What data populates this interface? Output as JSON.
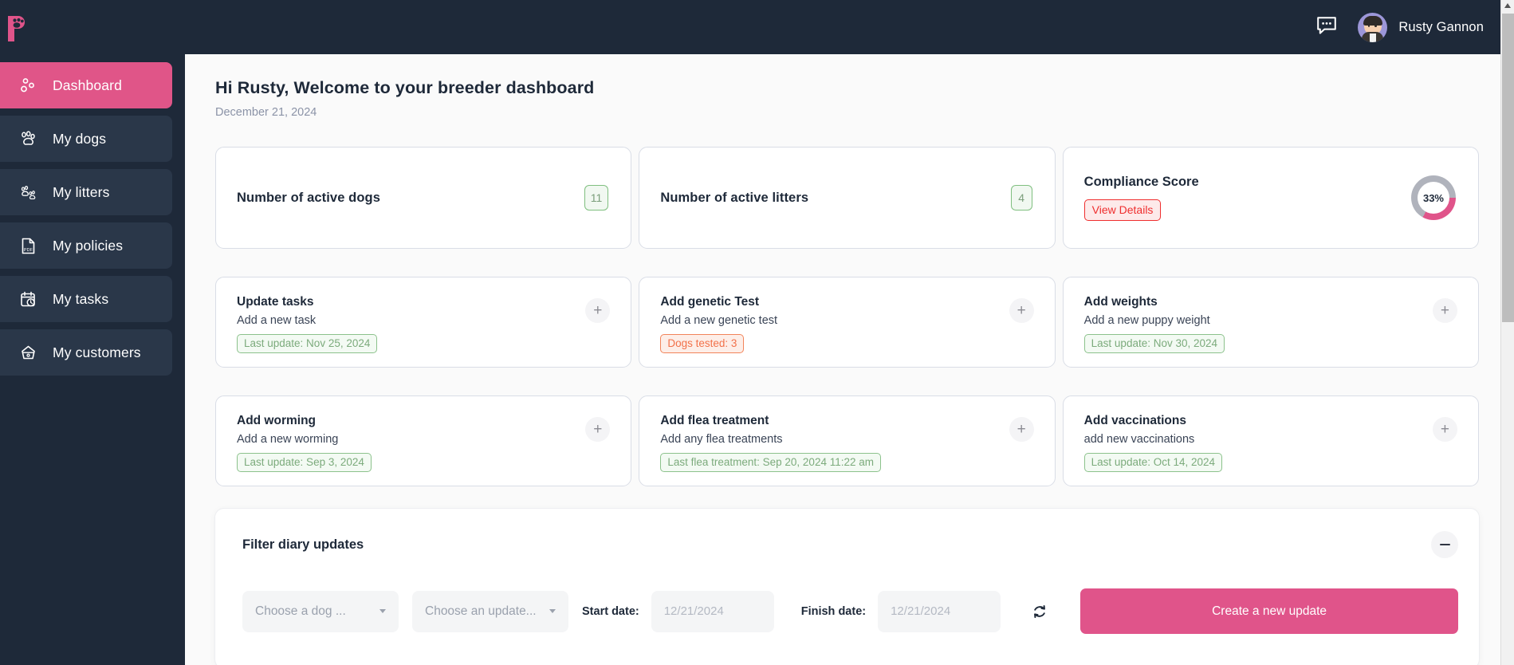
{
  "brand": {
    "logo_icon": "paw-p-logo-icon",
    "accent": "#e0548a",
    "dark": "#1e2939"
  },
  "topbar": {
    "chat_icon": "chat-bubble-icon",
    "user_name": "Rusty Gannon",
    "avatar_icon": "user-avatar"
  },
  "sidebar": {
    "items": [
      {
        "label": "Dashboard",
        "icon": "paw-dots-icon",
        "active": true
      },
      {
        "label": "My dogs",
        "icon": "paw-print-icon",
        "active": false
      },
      {
        "label": "My litters",
        "icon": "paw-litter-icon",
        "active": false
      },
      {
        "label": "My policies",
        "icon": "pdf-file-icon",
        "active": false
      },
      {
        "label": "My tasks",
        "icon": "calendar-clock-icon",
        "active": false
      },
      {
        "label": "My customers",
        "icon": "crown-icon",
        "active": false
      }
    ]
  },
  "main": {
    "greeting": "Hi Rusty, Welcome to your breeder dashboard",
    "date": "December 21, 2024",
    "stats": [
      {
        "title": "Number of active dogs",
        "value": "11"
      },
      {
        "title": "Number of active litters",
        "value": "4"
      }
    ],
    "compliance": {
      "title": "Compliance Score",
      "details_label": "View Details",
      "percent_label": "33%",
      "percent_value": 33,
      "fill_color": "#e0548a",
      "track_color": "#b0b3bc"
    },
    "actions": [
      {
        "title": "Update tasks",
        "subtitle": "Add a new task",
        "badge": "Last update: Nov 25, 2024",
        "badge_tone": "green",
        "add_icon": "plus-icon"
      },
      {
        "title": "Add genetic Test",
        "subtitle": "Add a new genetic test",
        "badge": "Dogs tested: 3",
        "badge_tone": "orange",
        "add_icon": "plus-icon"
      },
      {
        "title": "Add weights",
        "subtitle": "Add a new puppy weight",
        "badge": "Last update: Nov 30, 2024",
        "badge_tone": "green",
        "add_icon": "plus-icon"
      },
      {
        "title": "Add worming",
        "subtitle": "Add a new worming",
        "badge": "Last update: Sep 3, 2024",
        "badge_tone": "green",
        "add_icon": "plus-icon"
      },
      {
        "title": "Add flea treatment",
        "subtitle": "Add any flea treatments",
        "badge": "Last flea treatment: Sep 20, 2024 11:22 am",
        "badge_tone": "green",
        "add_icon": "plus-icon"
      },
      {
        "title": "Add vaccinations",
        "subtitle": "add new vaccinations",
        "badge": "Last update: Oct 14, 2024",
        "badge_tone": "green",
        "add_icon": "plus-icon"
      }
    ],
    "filter": {
      "title": "Filter diary updates",
      "collapse_icon": "minus-icon",
      "dog_select_value": "Choose a dog ...",
      "update_select_value": "Choose an update...",
      "start_date_label": "Start date:",
      "start_date_placeholder": "12/21/2024",
      "finish_date_label": "Finish date:",
      "finish_date_placeholder": "12/21/2024",
      "refresh_icon": "refresh-icon",
      "create_label": "Create a new update"
    }
  }
}
